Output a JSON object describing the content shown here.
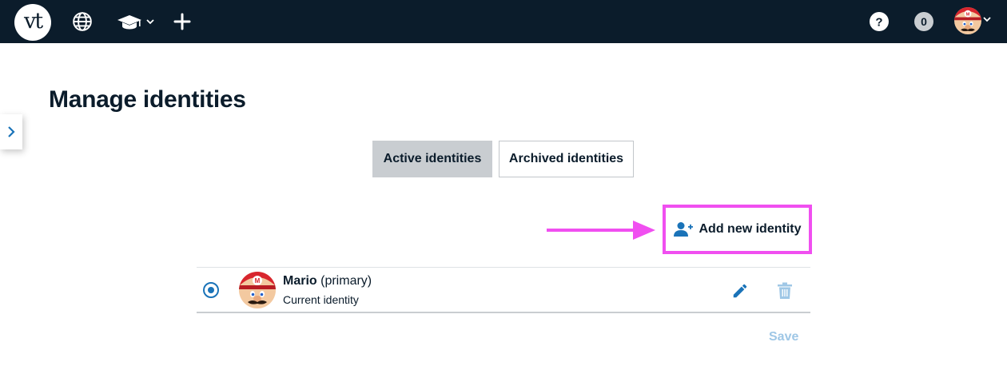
{
  "topbar": {
    "logo_text": "vt",
    "background": "#0b1c2b",
    "icons": [
      "globe-icon",
      "graduation-cap-icon",
      "chevron-down-icon",
      "plus-icon",
      "help-icon",
      "user-avatar",
      "chevron-down-icon"
    ],
    "notification_count": "0"
  },
  "page": {
    "title": "Manage identities"
  },
  "tabs": [
    {
      "label": "Active identities",
      "active": true
    },
    {
      "label": "Archived identities",
      "active": false
    }
  ],
  "actions": {
    "add_identity_label": "Add new identity",
    "highlight_color": "#f04ff0",
    "save_label": "Save"
  },
  "identities": [
    {
      "name": "Mario",
      "tag": "(primary)",
      "status": "Current identity",
      "selected": true
    }
  ],
  "colors": {
    "accent": "#1a73b8",
    "disabled": "#9fc7e6",
    "tab_active_bg": "#c9cdd1"
  }
}
